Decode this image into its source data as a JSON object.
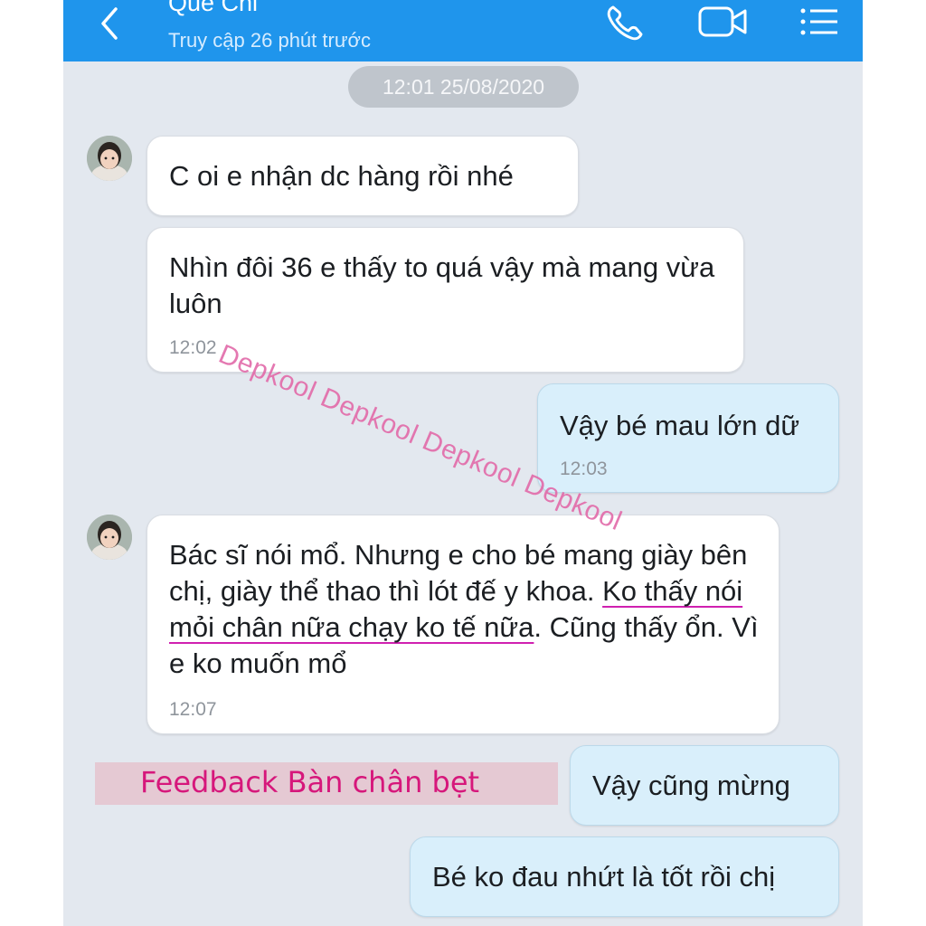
{
  "header": {
    "contact_name": "Quế Chi",
    "status": "Truy cập 26 phút trước",
    "icons": [
      "back-chevron-icon",
      "phone-icon",
      "video-call-icon",
      "menu-list-icon"
    ]
  },
  "conversation": {
    "date_stamp": "12:01 25/08/2020",
    "messages": [
      {
        "side": "in",
        "text": "C oi e nhận dc hàng rồi nhé"
      },
      {
        "side": "in",
        "text": "Nhìn đôi 36 e thấy to quá vậy mà mang vừa luôn",
        "time": "12:02"
      },
      {
        "side": "out",
        "text": "Vậy bé mau lớn dữ",
        "time": "12:03"
      },
      {
        "side": "in",
        "text_before": "Bác sĩ nói mổ. Nhưng e cho bé mang giày bên chị, giày thể thao thì lót đế y khoa. ",
        "text_underlined": "Ko thấy nói mỏi chân nữa chạy ko tế nữa",
        "text_after": ". Cũng thấy ổn. Vì e ko muốn mổ",
        "time": "12:07"
      },
      {
        "side": "out",
        "text": "Vậy cũng mừng"
      },
      {
        "side": "out",
        "text": "Bé ko đau nhứt là tốt rồi chị"
      }
    ]
  },
  "overlay": {
    "watermark": "Depkool Depkool Depkool Depkool",
    "feedback_label": "Feedback Bàn chân bẹt"
  },
  "colors": {
    "header_bg": "#1f95ec",
    "chat_bg": "#e3e8ef",
    "incoming_bubble": "#ffffff",
    "outgoing_bubble": "#d9effb",
    "highlight_underline": "#d020b0",
    "watermark": "#e26aa9"
  }
}
